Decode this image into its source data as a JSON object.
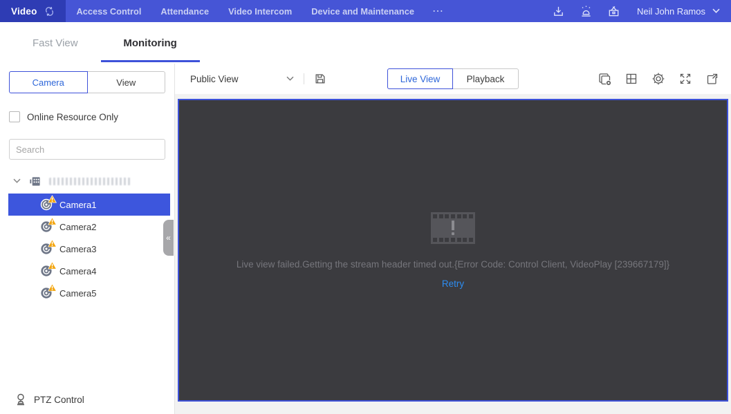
{
  "colors": {
    "accent": "#3d51d9",
    "nav_bg": "#4655d6",
    "nav_active_bg": "#2e3cb4",
    "selected_row": "#3d56dd",
    "warning_badge": "#f3a40c",
    "retry_link": "#2d8cf0",
    "video_bg": "#3b3b3f",
    "error_text": "#76767c"
  },
  "nav": {
    "active_module": "Video",
    "items": [
      "Access Control",
      "Attendance",
      "Video Intercom",
      "Device and Maintenance"
    ],
    "more_glyph": "⋯",
    "icons": [
      "switch-module-icon",
      "download-icon",
      "alarm-icon",
      "maintenance-toolbox-icon"
    ],
    "user_name": "Neil John Ramos"
  },
  "tabs": {
    "fast_view": "Fast View",
    "monitoring": "Monitoring",
    "active": "Monitoring"
  },
  "sidebar": {
    "resource_tabs": {
      "camera": "Camera",
      "view": "View",
      "active": "Camera"
    },
    "online_only_label": "Online Resource Only",
    "online_only_checked": false,
    "search_placeholder": "Search",
    "tree": {
      "root_label_obscured": true,
      "cameras": [
        {
          "label": "Camera1",
          "selected": true,
          "warning": true
        },
        {
          "label": "Camera2",
          "selected": false,
          "warning": true
        },
        {
          "label": "Camera3",
          "selected": false,
          "warning": true
        },
        {
          "label": "Camera4",
          "selected": false,
          "warning": true
        },
        {
          "label": "Camera5",
          "selected": false,
          "warning": true
        }
      ]
    },
    "collapse_glyph": "«",
    "ptz_label": "PTZ Control"
  },
  "toolbar": {
    "view_select": "Public View",
    "save_icon": "save-view-icon",
    "modes": {
      "live": "Live View",
      "playback": "Playback",
      "active": "Live View"
    },
    "icons": [
      "close-all-icon",
      "window-division-icon",
      "settings-gear-icon",
      "fullscreen-icon",
      "open-window-icon"
    ]
  },
  "video": {
    "error_message": "Live view failed.Getting the stream header timed out.{Error Code: Control Client, VideoPlay [239667179]}",
    "retry_label": "Retry"
  }
}
